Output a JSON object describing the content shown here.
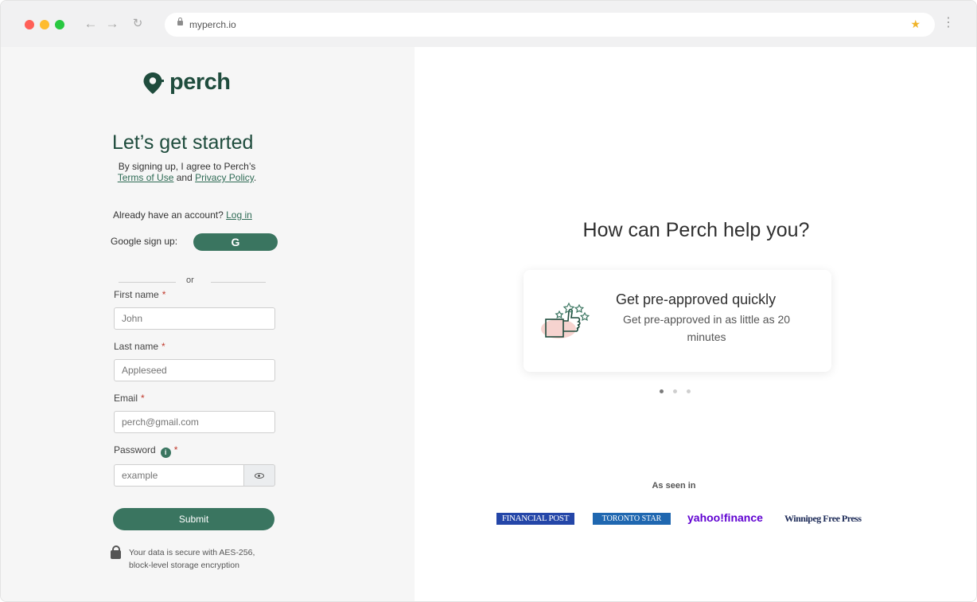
{
  "browser": {
    "url": "myperch.io",
    "colors": {
      "close": "#ff5f57",
      "minimize": "#febc2e",
      "maximize": "#28c840"
    }
  },
  "brand": {
    "name": "perch",
    "color": "#1f4c3d",
    "accent": "#3a7560"
  },
  "signup": {
    "title": "Let’s get started",
    "agree_prefix": "By signing up, I agree to Perch’s",
    "terms_link": "Terms of Use",
    "and_text": "and",
    "privacy_link": "Privacy Policy",
    "period": ".",
    "already_text": "Already have an account?",
    "login_link": "Log in",
    "google_label": "Google sign up:",
    "google_icon": "G",
    "or_text": "or",
    "fields": {
      "first_name": {
        "label": "First name",
        "placeholder": "John"
      },
      "last_name": {
        "label": "Last name",
        "placeholder": "Appleseed"
      },
      "email": {
        "label": "Email",
        "placeholder": "perch@gmail.com"
      },
      "password": {
        "label": "Password",
        "placeholder": "example"
      }
    },
    "required_mark": "*",
    "submit_label": "Submit",
    "security_line1": "Your data is secure with AES-256,",
    "security_line2": "block-level storage encryption"
  },
  "promo": {
    "heading": "How can Perch help you?",
    "card_title": "Get pre-approved quickly",
    "card_desc": "Get pre-approved in as little as 20 minutes",
    "carousel_active_index": 0,
    "carousel_count": 3
  },
  "press": {
    "heading": "As seen in",
    "logos": [
      "FINANCIAL POST",
      "TORONTO STAR",
      "yahoo!finance",
      "Winnipeg Free Press"
    ]
  }
}
